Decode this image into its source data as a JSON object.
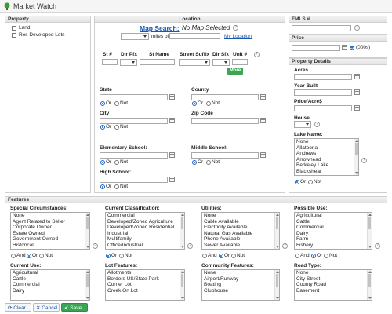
{
  "window": {
    "title": "Market Watch"
  },
  "property": {
    "header": "Property",
    "land_label": "Land",
    "res_developed_label": "Res Developed Lots"
  },
  "location": {
    "header": "Location",
    "map_search_label": "Map Search:",
    "map_status": "No Map Selected",
    "miles_of_label": "miles of",
    "my_location_link": "My Location",
    "street_cols": [
      "St #",
      "Dir Pfx",
      "St Name",
      "Street Suffix",
      "Dir Sfx",
      "Unit #"
    ],
    "more_button": "More",
    "state_label": "State",
    "county_label": "County",
    "city_label": "City",
    "zip_label": "Zip Code",
    "elementary_label": "Elementary School:",
    "middle_label": "Middle School:",
    "high_label": "High School:",
    "or_label": "Or",
    "not_label": "Not"
  },
  "right": {
    "fmls_header": "FMLS #",
    "price_header": "Price",
    "price_unit_label": "(000s)",
    "details_header": "Property Details",
    "acres_label": "Acres",
    "year_built_label": "Year Built",
    "price_acre_label": "Price/Acre$",
    "house_label": "House",
    "lake_name_label": "Lake Name:",
    "lake_options": [
      "None",
      "Allatoona",
      "Andrews",
      "Arrowhead",
      "Berkeley Lake",
      "Blackshear"
    ],
    "or_label": "Or",
    "not_label": "Not"
  },
  "features": {
    "header": "Features",
    "special_label": "Special Circumstances:",
    "special_options": [
      "None",
      "Agent Related to Seller",
      "Corporate Owner",
      "Estate Owned",
      "Government Owned",
      "Historical"
    ],
    "classification_label": "Current Classification:",
    "classification_options": [
      "Commercial",
      "Developed/Zoned Agriculture",
      "Developed/Zoned Residential",
      "Industrial",
      "Multifamily",
      "Office/Industrial"
    ],
    "utilities_label": "Utilities:",
    "utilities_options": [
      "None",
      "Cable Available",
      "Electricity Available",
      "Natural Gas Available",
      "Phone Available",
      "Sewer Available"
    ],
    "possible_label": "Possible Use:",
    "possible_options": [
      "Agricultural",
      "Cattle",
      "Commercial",
      "Dairy",
      "Farm",
      "Fishery"
    ],
    "current_use_label": "Current Use:",
    "current_use_options": [
      "Agricultural",
      "Cattle",
      "Commercial",
      "Dairy"
    ],
    "lot_label": "Lot Features:",
    "lot_options": [
      "Allotments",
      "Borders US/State Park",
      "Corner Lot",
      "Creek On Lot"
    ],
    "community_label": "Community Features:",
    "community_options": [
      "None",
      "Airport/Runway",
      "Boating",
      "Clubhouse"
    ],
    "road_label": "Road Type:",
    "road_options": [
      "None",
      "City Street",
      "County Road",
      "Easement"
    ],
    "and_label": "And",
    "or_label": "Or",
    "not_label": "Not"
  },
  "actions": {
    "clear": "Clear",
    "cancel": "Cancel",
    "save": "Save"
  },
  "colors": {
    "accent_blue": "#1a55b0",
    "save_green": "#3aa655",
    "checkbox_checked": "#2a6fd1"
  }
}
